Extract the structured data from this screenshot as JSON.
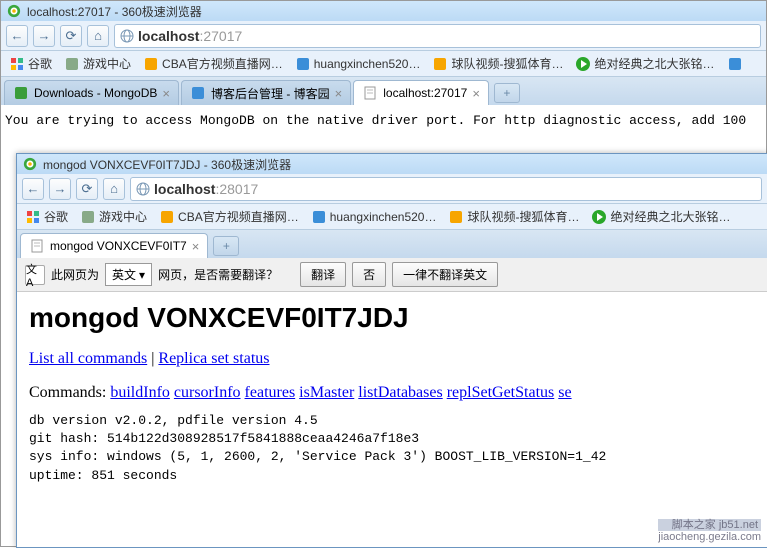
{
  "outer": {
    "title": "localhost:27017 - 360极速浏览器",
    "address_host": "localhost",
    "address_port": ":27017",
    "bookmarks": [
      {
        "label": "谷歌",
        "icon": "google"
      },
      {
        "label": "游戏中心",
        "icon": "game"
      },
      {
        "label": "CBA官方视频直播网…",
        "icon": "hand"
      },
      {
        "label": "huangxinchen520…",
        "icon": "blue"
      },
      {
        "label": "球队视频-搜狐体育…",
        "icon": "hand"
      },
      {
        "label": "绝对经典之北大张铭…",
        "icon": "play"
      },
      {
        "label": "",
        "icon": "bluebox"
      }
    ],
    "tabs": [
      {
        "label": "Downloads - MongoDB",
        "active": false,
        "icon": "green"
      },
      {
        "label": "博客后台管理 - 博客园",
        "active": false,
        "icon": "blue"
      },
      {
        "label": "localhost:27017",
        "active": true,
        "icon": "doc"
      }
    ],
    "content_line": "You are trying to access MongoDB on the native driver port. For http diagnostic access, add 100"
  },
  "inner": {
    "title": "mongod VONXCEVF0IT7JDJ - 360极速浏览器",
    "address_host": "localhost",
    "address_port": ":28017",
    "bookmarks": [
      {
        "label": "谷歌",
        "icon": "google"
      },
      {
        "label": "游戏中心",
        "icon": "game"
      },
      {
        "label": "CBA官方视频直播网…",
        "icon": "hand"
      },
      {
        "label": "huangxinchen520…",
        "icon": "blue"
      },
      {
        "label": "球队视频-搜狐体育…",
        "icon": "hand"
      },
      {
        "label": "绝对经典之北大张铭…",
        "icon": "play"
      }
    ],
    "tabs": [
      {
        "label": "mongod VONXCEVF0IT7",
        "active": true,
        "icon": "doc"
      }
    ],
    "translate": {
      "prefix": "此网页为",
      "lang": "英文",
      "suffix": "网页，是否需要翻译？",
      "translate_btn": "翻译",
      "no_btn": "否",
      "never_btn": "一律不翻译英文"
    },
    "page": {
      "heading": "mongod VONXCEVF0IT7JDJ",
      "link1": "List all commands",
      "sep": " | ",
      "link2": "Replica set status",
      "commands_label": "Commands: ",
      "commands": [
        "buildInfo",
        "cursorInfo",
        "features",
        "isMaster",
        "listDatabases",
        "replSetGetStatus",
        "se"
      ],
      "sys1": "db version v2.0.2, pdfile version 4.5",
      "sys2": "git hash: 514b122d308928517f5841888ceaa4246a7f18e3",
      "sys3": "sys info: windows (5, 1, 2600, 2, 'Service Pack 3') BOOST_LIB_VERSION=1_42",
      "sys4": "uptime: 851 seconds"
    }
  },
  "watermark": {
    "l1": "脚本之家 jb51.net",
    "l2": "jiaocheng.gezila.com"
  }
}
